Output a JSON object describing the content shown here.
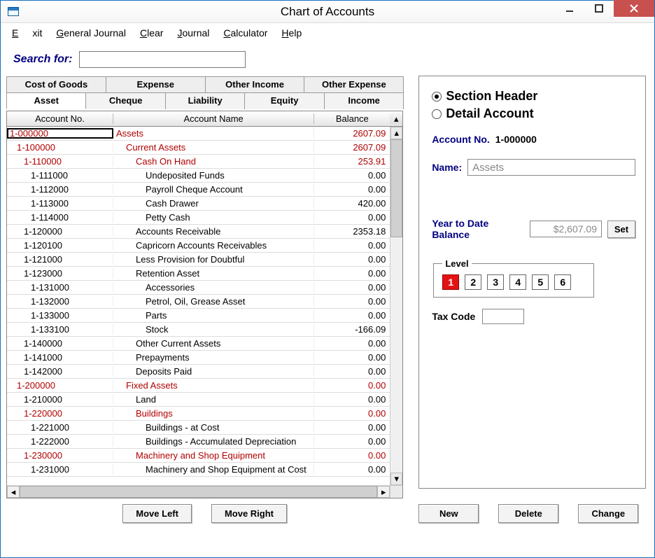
{
  "window": {
    "title": "Chart of Accounts"
  },
  "menu": {
    "exit": "Exit",
    "general_journal": "General Journal",
    "clear": "Clear",
    "journal": "Journal",
    "calculator": "Calculator",
    "help": "Help"
  },
  "search": {
    "label": "Search for:",
    "value": ""
  },
  "tabs_row1": {
    "cost_of_goods": "Cost of Goods",
    "expense": "Expense",
    "other_income": "Other Income",
    "other_expense": "Other Expense"
  },
  "tabs_row2": {
    "asset": "Asset",
    "cheque": "Cheque",
    "liability": "Liability",
    "equity": "Equity",
    "income": "Income"
  },
  "columns": {
    "no": "Account No.",
    "name": "Account Name",
    "bal": "Balance"
  },
  "rows": [
    {
      "no": "1-000000",
      "name": "Assets",
      "bal": "2607.09",
      "header": true,
      "indent_no": 0,
      "indent_name": 0,
      "selected": true
    },
    {
      "no": "1-100000",
      "name": "Current Assets",
      "bal": "2607.09",
      "header": true,
      "indent_no": 1,
      "indent_name": 1
    },
    {
      "no": "1-110000",
      "name": "Cash On Hand",
      "bal": "253.91",
      "header": true,
      "indent_no": 2,
      "indent_name": 2
    },
    {
      "no": "1-111000",
      "name": "Undeposited Funds",
      "bal": "0.00",
      "indent_no": 3,
      "indent_name": 3
    },
    {
      "no": "1-112000",
      "name": "Payroll Cheque Account",
      "bal": "0.00",
      "indent_no": 3,
      "indent_name": 3
    },
    {
      "no": "1-113000",
      "name": "Cash Drawer",
      "bal": "420.00",
      "indent_no": 3,
      "indent_name": 3
    },
    {
      "no": "1-114000",
      "name": "Petty Cash",
      "bal": "0.00",
      "indent_no": 3,
      "indent_name": 3
    },
    {
      "no": "1-120000",
      "name": "Accounts Receivable",
      "bal": "2353.18",
      "indent_no": 2,
      "indent_name": 2
    },
    {
      "no": "1-120100",
      "name": "Capricorn Accounts Receivables",
      "bal": "0.00",
      "indent_no": 2,
      "indent_name": 2
    },
    {
      "no": "1-121000",
      "name": "Less Provision for Doubtful",
      "bal": "0.00",
      "indent_no": 2,
      "indent_name": 2
    },
    {
      "no": "1-123000",
      "name": "Retention Asset",
      "bal": "0.00",
      "indent_no": 2,
      "indent_name": 2
    },
    {
      "no": "1-131000",
      "name": "Accessories",
      "bal": "0.00",
      "indent_no": 3,
      "indent_name": 3
    },
    {
      "no": "1-132000",
      "name": "Petrol, Oil, Grease Asset",
      "bal": "0.00",
      "indent_no": 3,
      "indent_name": 3
    },
    {
      "no": "1-133000",
      "name": "Parts",
      "bal": "0.00",
      "indent_no": 3,
      "indent_name": 3
    },
    {
      "no": "1-133100",
      "name": "Stock",
      "bal": "-166.09",
      "indent_no": 3,
      "indent_name": 3
    },
    {
      "no": "1-140000",
      "name": "Other Current Assets",
      "bal": "0.00",
      "indent_no": 2,
      "indent_name": 2
    },
    {
      "no": "1-141000",
      "name": "Prepayments",
      "bal": "0.00",
      "indent_no": 2,
      "indent_name": 2
    },
    {
      "no": "1-142000",
      "name": "Deposits Paid",
      "bal": "0.00",
      "indent_no": 2,
      "indent_name": 2
    },
    {
      "no": "1-200000",
      "name": "Fixed Assets",
      "bal": "0.00",
      "header": true,
      "indent_no": 1,
      "indent_name": 1
    },
    {
      "no": "1-210000",
      "name": "Land",
      "bal": "0.00",
      "indent_no": 2,
      "indent_name": 2
    },
    {
      "no": "1-220000",
      "name": "Buildings",
      "bal": "0.00",
      "header": true,
      "indent_no": 2,
      "indent_name": 2
    },
    {
      "no": "1-221000",
      "name": "Buildings - at Cost",
      "bal": "0.00",
      "indent_no": 3,
      "indent_name": 3
    },
    {
      "no": "1-222000",
      "name": "Buildings - Accumulated Depreciation",
      "bal": "0.00",
      "indent_no": 3,
      "indent_name": 3
    },
    {
      "no": "1-230000",
      "name": "Machinery and Shop Equipment",
      "bal": "0.00",
      "header": true,
      "indent_no": 2,
      "indent_name": 2
    },
    {
      "no": "1-231000",
      "name": "Machinery and Shop Equipment at Cost",
      "bal": "0.00",
      "indent_no": 3,
      "indent_name": 3
    }
  ],
  "move": {
    "left": "Move Left",
    "right": "Move Right"
  },
  "detail": {
    "radio_section": "Section Header",
    "radio_detail": "Detail Account",
    "account_no_label": "Account No.",
    "account_no_value": "1-000000",
    "name_label": "Name:",
    "name_value": "Assets",
    "ytd_label": "Year to Date Balance",
    "ytd_value": "$2,607.09",
    "set": "Set",
    "level_label": "Level",
    "levels": [
      "1",
      "2",
      "3",
      "4",
      "5",
      "6"
    ],
    "tax_label": "Tax Code",
    "tax_value": ""
  },
  "actions": {
    "new": "New",
    "delete": "Delete",
    "change": "Change"
  }
}
